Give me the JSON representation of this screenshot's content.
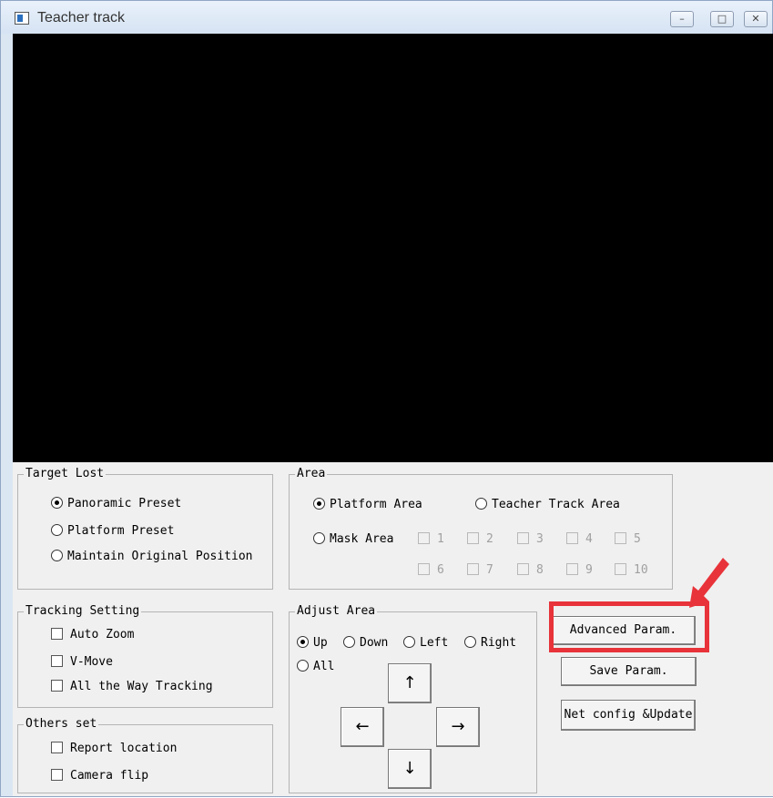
{
  "window": {
    "title": "Teacher track",
    "min_glyph": "–",
    "max_glyph": "□",
    "close_glyph": "✕"
  },
  "target_lost": {
    "title": "Target Lost",
    "options": [
      "Panoramic Preset",
      "Platform Preset",
      "Maintain Original Position"
    ],
    "selected": "Panoramic Preset"
  },
  "area": {
    "title": "Area",
    "options": [
      "Platform Area",
      "Teacher Track Area",
      "Mask Area"
    ],
    "selected": "Platform Area",
    "mask_numbers": [
      "1",
      "2",
      "3",
      "4",
      "5",
      "6",
      "7",
      "8",
      "9",
      "10"
    ]
  },
  "tracking_setting": {
    "title": "Tracking Setting",
    "items": [
      "Auto Zoom",
      "V-Move",
      "All the Way Tracking"
    ]
  },
  "others_set": {
    "title": "Others set",
    "items": [
      "Report location",
      "Camera flip"
    ]
  },
  "adjust_area": {
    "title": "Adjust Area",
    "options": [
      "Up",
      "Down",
      "Left",
      "Right",
      "All"
    ],
    "selected": "Up",
    "arrows": {
      "up": "↑",
      "left": "←",
      "right": "→",
      "down": "↓"
    }
  },
  "buttons": {
    "advanced": "Advanced Param.",
    "save": "Save Param.",
    "net": "Net config &Update"
  },
  "annotation": {
    "color": "#e8333a"
  }
}
